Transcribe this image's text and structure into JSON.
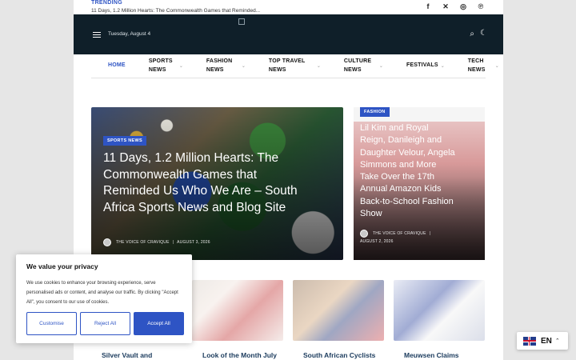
{
  "topbar": {
    "trending_label": "TRENDING",
    "trending_text": "11 Days, 1.2 Million Hearts: The Commonwealth Games that Reminded...",
    "social": [
      "facebook-icon",
      "x-icon",
      "instagram-icon",
      "pinterest-icon"
    ]
  },
  "header": {
    "date": "Tuesday, August 4"
  },
  "nav": {
    "items": [
      {
        "label": "HOME",
        "active": true
      },
      {
        "label": "SPORTS NEWS"
      },
      {
        "label": "FASHION NEWS"
      },
      {
        "label": "TOP TRAVEL NEWS"
      },
      {
        "label": "CULTURE NEWS"
      },
      {
        "label": "FESTIVALS"
      },
      {
        "label": "TECH NEWS"
      }
    ]
  },
  "hero": {
    "category": "SPORTS NEWS",
    "title": "11 Days, 1.2 Million Hearts: The Commonwealth Games that Reminded Us Who We Are – South Africa Sports News and Blog Site",
    "author": "THE VOICE OF CRAVIQUE",
    "date": "AUGUST 3, 2026"
  },
  "side": {
    "category": "FASHION",
    "title": "Lil Kim and Royal Reign, Danileigh and Daughter Velour, Angela Simmons and More Take Over the 17th Annual Amazon Kids Back-to-School Fashion Show",
    "author": "THE VOICE OF CRAVIQUE",
    "date": "AUGUST 2, 2026"
  },
  "cards": [
    {
      "title": "Silver Vault and"
    },
    {
      "title": "Look of the Month July"
    },
    {
      "title": "South African Cyclists"
    },
    {
      "title": "Meuwsen Claims"
    }
  ],
  "cookie": {
    "title": "We value your privacy",
    "text": "We use cookies to enhance your browsing experience, serve personalised ads or content, and analyse our traffic. By clicking \"Accept All\", you consent to our use of cookies.",
    "customise": "Customise",
    "reject": "Reject All",
    "accept": "Accept All"
  },
  "language": {
    "code": "EN"
  },
  "colors": {
    "accent": "#2e54c4",
    "header_bg": "#0f1f29"
  }
}
